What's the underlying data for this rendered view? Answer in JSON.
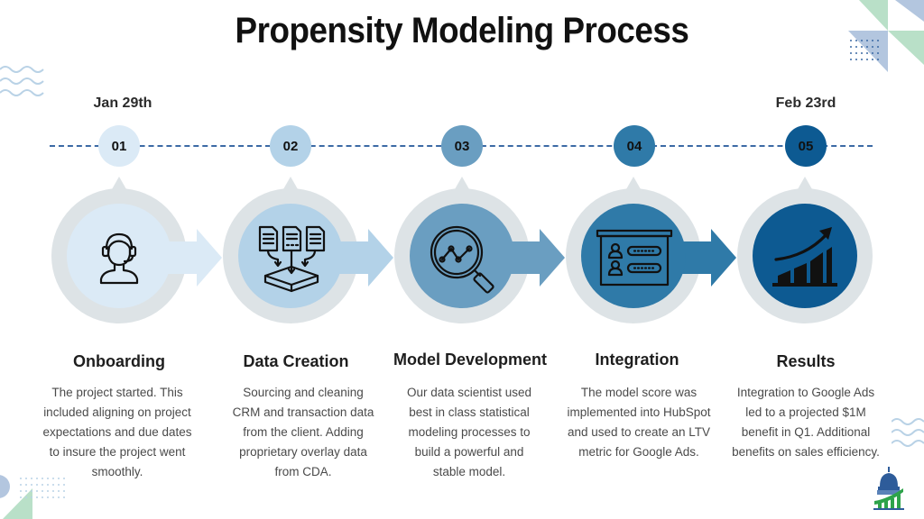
{
  "title": "Propensity Modeling Process",
  "dates": {
    "start": "Jan 29th",
    "end": "Feb 23rd"
  },
  "colors": {
    "ring": "#dde3e6",
    "timeline": "#3c6aa5",
    "step_fills": [
      "#dbeaf6",
      "#b3d2e8",
      "#6a9ec1",
      "#2f7aa8",
      "#0d5a92"
    ]
  },
  "steps": [
    {
      "number": "01",
      "icon": "customer-support-headset-icon",
      "heading": "Onboarding",
      "description": "The project started. This included aligning on project expectations and due dates to insure the project went smoothly."
    },
    {
      "number": "02",
      "icon": "documents-into-database-icon",
      "heading": "Data Creation",
      "description": "Sourcing and cleaning CRM and transaction data from the client. Adding proprietary overlay data from CDA."
    },
    {
      "number": "03",
      "icon": "magnifier-chart-analysis-icon",
      "heading": "Model Development",
      "description": "Our data scientist used best in class statistical modeling processes to build a powerful and stable model."
    },
    {
      "number": "04",
      "icon": "presentation-board-users-icon",
      "heading": "Integration",
      "description": "The model score was implemented into HubSpot and used to create an LTV metric for Google Ads."
    },
    {
      "number": "05",
      "icon": "growth-bar-chart-icon",
      "heading": "Results",
      "description": "Integration to Google Ads led to a projected $1M benefit in Q1. Additional benefits on sales efficiency."
    }
  ]
}
